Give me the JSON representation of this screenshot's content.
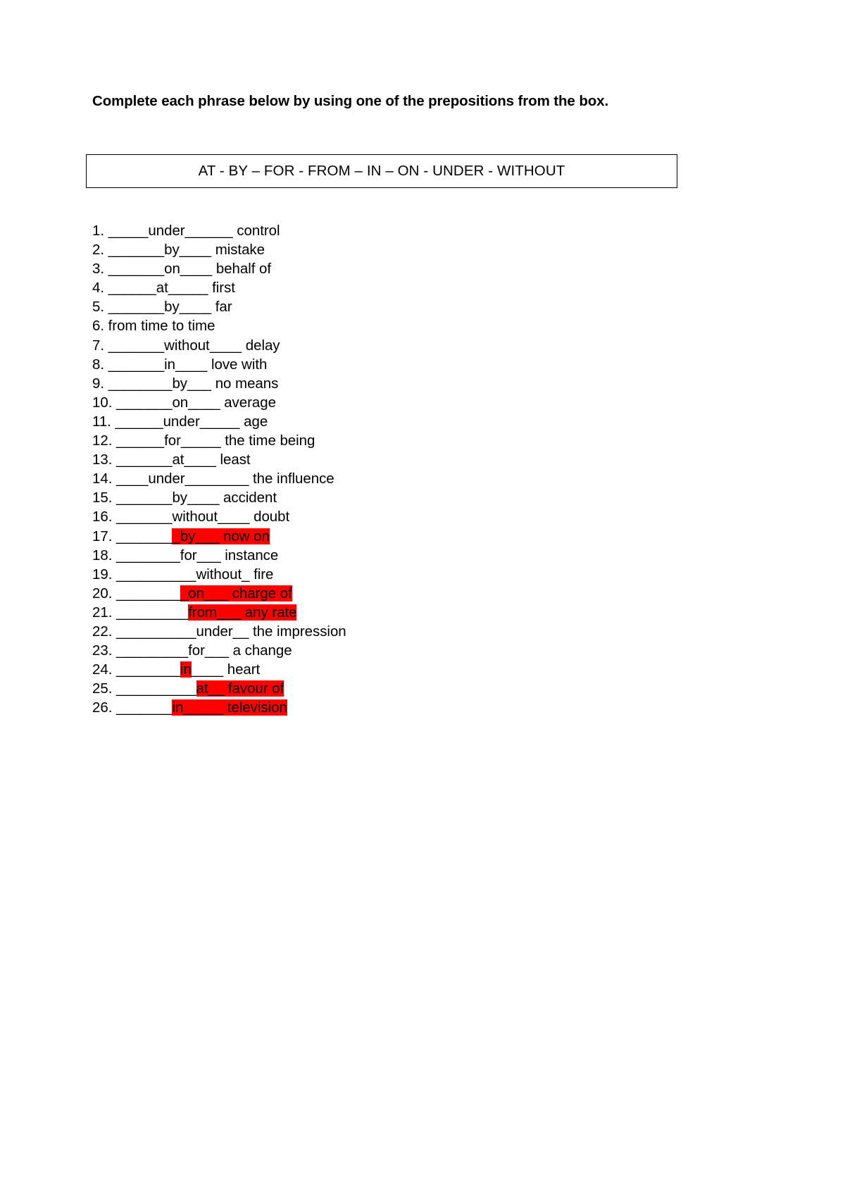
{
  "document": {
    "title": "Complete each phrase below by using one of the prepositions from the box.",
    "prepositions_box": "AT - BY – FOR - FROM – IN – ON - UNDER - WITHOUT",
    "highlight_color": "#FF0000",
    "exercises": [
      {
        "number": "1.",
        "text": "_____under______ control",
        "pre": "1. _____under______ control",
        "highlight": "none"
      },
      {
        "number": "2.",
        "text": "_______by____ mistake",
        "pre": "2. _______by____ mistake",
        "highlight": "none"
      },
      {
        "number": "3.",
        "text": "_______on____ behalf of",
        "pre": "3. _______on____ behalf of",
        "highlight": "none"
      },
      {
        "number": "4.",
        "text": "______at_____ first",
        "pre": "4. ______at_____ first",
        "highlight": "none"
      },
      {
        "number": "5.",
        "text": "_______by____ far",
        "pre": "5. _______by____ far",
        "highlight": "none"
      },
      {
        "number": "6.",
        "text": "from time to time",
        "pre": "6. from time to time",
        "highlight": "none"
      },
      {
        "number": "7.",
        "text": "_______without____ delay",
        "pre": "7. _______without____ delay",
        "highlight": "none"
      },
      {
        "number": "8.",
        "text": "_______in____ love with",
        "pre": "8. _______in____ love with",
        "highlight": "none"
      },
      {
        "number": "9.",
        "text": "________by___ no means",
        "pre": "9. ________by___ no means",
        "highlight": "none"
      },
      {
        "number": "10.",
        "text": "_______on____ average",
        "pre": "10. _______on____ average",
        "highlight": "none"
      },
      {
        "number": "11.",
        "text": "______under_____ age",
        "pre": "11. ______under_____ age",
        "highlight": "none"
      },
      {
        "number": "12.",
        "text": "______for_____ the time being",
        "pre": "12. ______for_____ the time being",
        "highlight": "none"
      },
      {
        "number": "13.",
        "text": "_______at____ least",
        "pre": "13. _______at____ least",
        "highlight": "none"
      },
      {
        "number": "14.",
        "text": "____under________ the influence",
        "pre": "14. ____under________ the influence",
        "highlight": "none"
      },
      {
        "number": "15.",
        "text": "_______by____ accident",
        "pre": "15. _______by____ accident",
        "highlight": "none"
      },
      {
        "number": "16.",
        "text": "_______without____ doubt",
        "pre": "16. _______without____ doubt",
        "highlight": "none"
      },
      {
        "number": "17.",
        "text": "_______by___ now on",
        "plain": "17. _______",
        "marked": "_by___ now on",
        "highlight": "partial"
      },
      {
        "number": "18.",
        "text": "________for___ instance",
        "pre": "18. ________for___ instance",
        "highlight": "none"
      },
      {
        "number": "19.",
        "text": "__________without_ fire",
        "pre": "19. __________without_ fire",
        "highlight": "none"
      },
      {
        "number": "20.",
        "text": "________on___ charge of",
        "plain": "20. ________",
        "marked": "_on___ charge of",
        "highlight": "partial"
      },
      {
        "number": "21.",
        "text": "_________from___ any rate",
        "plain": "21. _________",
        "marked": "from___ any rate",
        "highlight": "partial"
      },
      {
        "number": "22.",
        "text": "__________under__ the impression",
        "pre": "22. __________under__ the impression",
        "highlight": "none"
      },
      {
        "number": "23.",
        "text": "_________for___ a change",
        "pre": "23. _________for___ a change",
        "highlight": "none"
      },
      {
        "number": "24.",
        "text": "________in____ heart",
        "plain": "24. ________",
        "marked": "in",
        "post": "____ heart",
        "highlight": "partial"
      },
      {
        "number": "25.",
        "text": "__________at__ favour of",
        "plain": "25. __________",
        "marked": "at__ favour of",
        "highlight": "partial"
      },
      {
        "number": "26.",
        "text": "_______in_____ television",
        "plain": "26. _______",
        "marked": "in_____ television",
        "highlight": "partial"
      }
    ]
  }
}
